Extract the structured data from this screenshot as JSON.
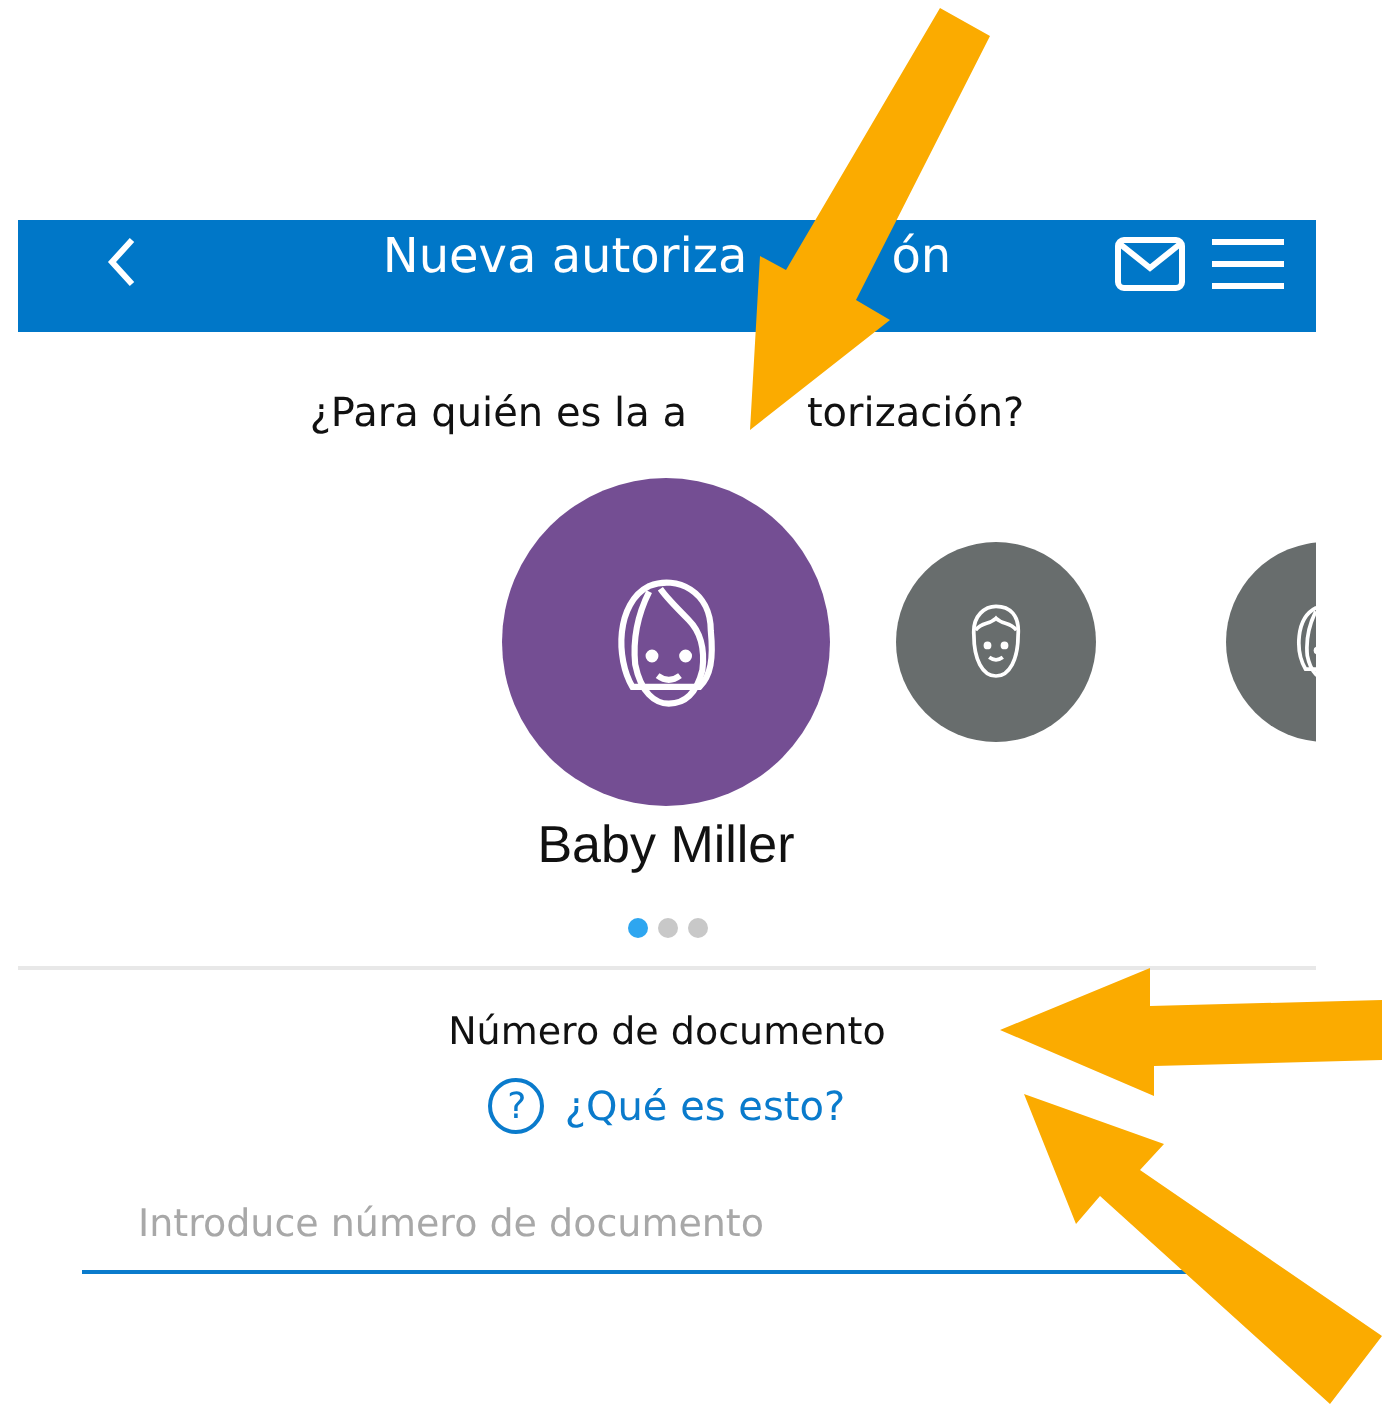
{
  "header": {
    "title_parts": [
      "Nueva autoriza",
      "ón"
    ]
  },
  "question_parts": [
    "¿Para quién es la a",
    "torización?"
  ],
  "profiles": [
    {
      "name": "Baby Miller",
      "selected": true,
      "kind": "girl"
    },
    {
      "selected": false,
      "kind": "boy"
    },
    {
      "selected": false,
      "kind": "girl"
    }
  ],
  "pager": [
    {
      "selected": true
    },
    {
      "selected": false
    },
    {
      "selected": false
    }
  ],
  "document": {
    "label": "Número de documento",
    "help_link": "¿Qué es esto?",
    "icon_text": "?",
    "placeholder": "Introduce número de documento"
  }
}
